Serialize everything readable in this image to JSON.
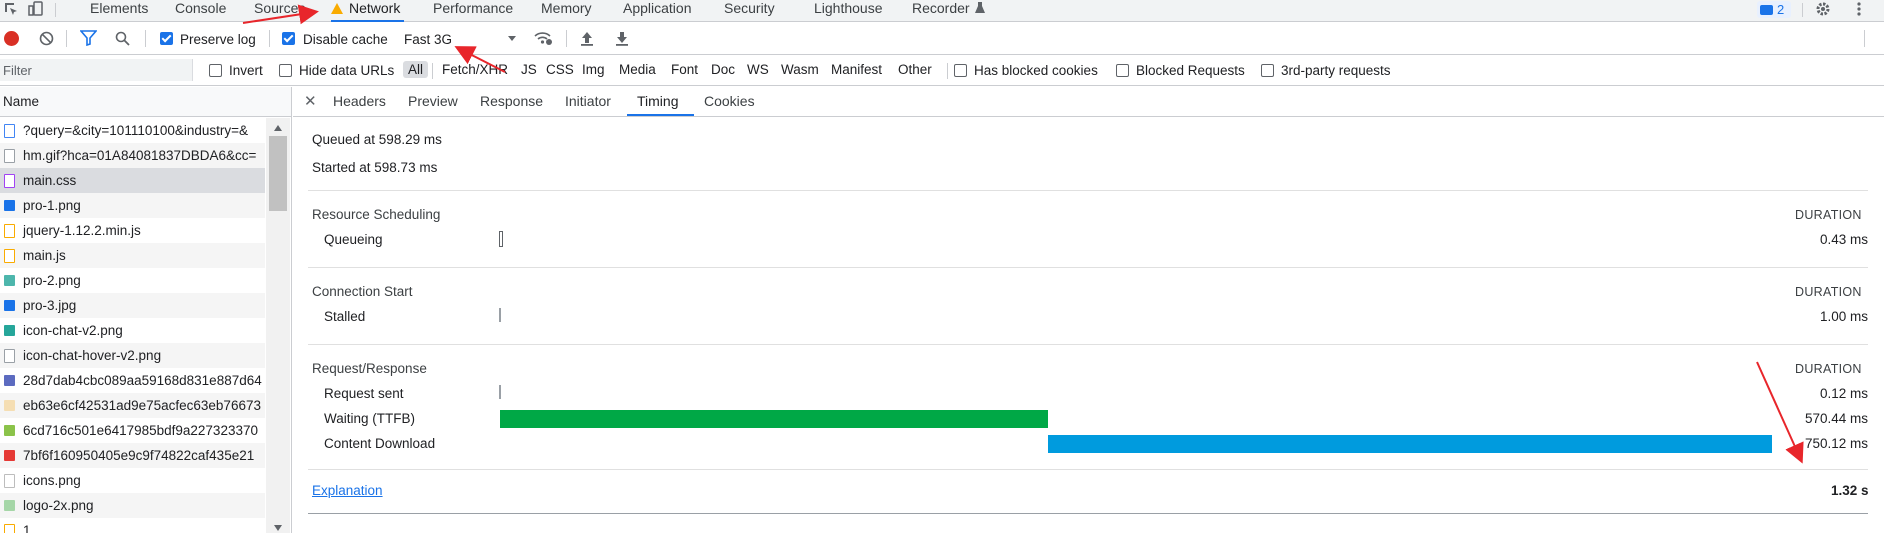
{
  "top_tabs": [
    "Elements",
    "Console",
    "Sources",
    "Network",
    "Performance",
    "Memory",
    "Application",
    "Security",
    "Lighthouse",
    "Recorder"
  ],
  "issues_badge": "2",
  "toolbar": {
    "preserve_log": "Preserve log",
    "disable_cache": "Disable cache",
    "throttle": "Fast 3G"
  },
  "filter": {
    "placeholder": "Filter",
    "invert": "Invert",
    "hide_data_urls": "Hide data URLs",
    "types": [
      "All",
      "Fetch/XHR",
      "JS",
      "CSS",
      "Img",
      "Media",
      "Font",
      "Doc",
      "WS",
      "Wasm",
      "Manifest",
      "Other"
    ],
    "blocked_cookies": "Has blocked cookies",
    "blocked_requests": "Blocked Requests",
    "third_party": "3rd-party requests"
  },
  "requests": {
    "header": "Name",
    "items": [
      {
        "name": "?query=&city=101110100&industry=&",
        "icon": "document-icon",
        "color": "#4285f4"
      },
      {
        "name": "hm.gif?hca=01A84081837DBDA6&cc=",
        "icon": "blank-file-icon",
        "color": "#9aa0a6"
      },
      {
        "name": "main.css",
        "icon": "stylesheet-icon",
        "color": "#a142f4"
      },
      {
        "name": "pro-1.png",
        "icon": "image-icon",
        "color": "#1a73e8"
      },
      {
        "name": "jquery-1.12.2.min.js",
        "icon": "script-icon",
        "color": "#f9ab00"
      },
      {
        "name": "main.js",
        "icon": "script-icon",
        "color": "#f9ab00"
      },
      {
        "name": "pro-2.png",
        "icon": "image-icon",
        "color": "#4db6ac"
      },
      {
        "name": "pro-3.jpg",
        "icon": "image-icon",
        "color": "#1a73e8"
      },
      {
        "name": "icon-chat-v2.png",
        "icon": "image-icon",
        "color": "#26a69a"
      },
      {
        "name": "icon-chat-hover-v2.png",
        "icon": "blank-file-icon",
        "color": "#9aa0a6"
      },
      {
        "name": "28d7dab4cbc089aa59168d831e887d64",
        "icon": "image-icon",
        "color": "#5c6bc0"
      },
      {
        "name": "eb63e6cf42531ad9e75acfec63eb76673",
        "icon": "image-icon",
        "color": "#f5deb3"
      },
      {
        "name": "6cd716c501e6417985bdf9a227323370",
        "icon": "image-icon",
        "color": "#8bc34a"
      },
      {
        "name": "7bf6f160950405e9c9f74822caf435e21",
        "icon": "image-icon",
        "color": "#e53935"
      },
      {
        "name": "icons.png",
        "icon": "blank-file-icon",
        "color": "#bdbdbd"
      },
      {
        "name": "logo-2x.png",
        "icon": "image-icon",
        "color": "#a5d6a7"
      },
      {
        "name": "1 ",
        "icon": "script-icon",
        "color": "#f9ab00"
      }
    ]
  },
  "detail_tabs": [
    "Headers",
    "Preview",
    "Response",
    "Initiator",
    "Timing",
    "Cookies"
  ],
  "timing": {
    "queued": "Queued at 598.29 ms",
    "started": "Started at 598.73 ms",
    "duration_label": "DURATION",
    "sections": [
      {
        "title": "Resource Scheduling",
        "rows": [
          {
            "label": "Queueing",
            "duration": "0.43 ms",
            "start_frac": 0.0,
            "width_frac": 0.0
          }
        ]
      },
      {
        "title": "Connection Start",
        "rows": [
          {
            "label": "Stalled",
            "duration": "1.00 ms",
            "start_frac": 0.0,
            "width_frac": 0.0
          }
        ]
      },
      {
        "title": "Request/Response",
        "rows": [
          {
            "label": "Request sent",
            "duration": "0.12 ms",
            "start_frac": 0.0,
            "width_frac": 0.0
          },
          {
            "label": "Waiting (TTFB)",
            "duration": "570.44 ms",
            "start_frac": 0.0,
            "width_frac": 0.431,
            "color": "#00a846"
          },
          {
            "label": "Content Download",
            "duration": "750.12 ms",
            "start_frac": 0.431,
            "width_frac": 0.569,
            "color": "#009bde"
          }
        ]
      }
    ],
    "explanation": "Explanation",
    "total": "1.32 s"
  },
  "colors": {
    "accent": "#1a73e8",
    "ttfb": "#00a846",
    "download": "#009bde",
    "annotation": "#e8262b"
  }
}
